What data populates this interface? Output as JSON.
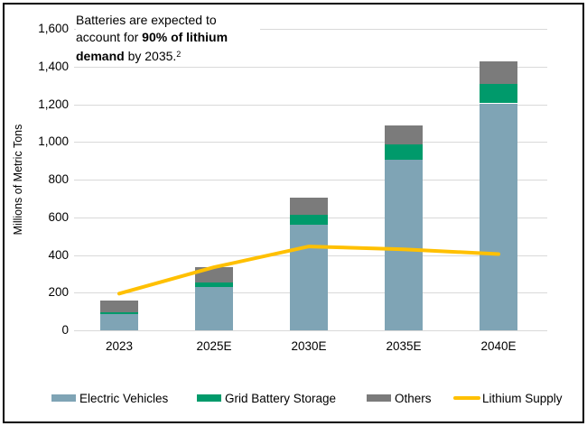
{
  "annotation": {
    "part1": "Batteries are expected to account for ",
    "bold": "90% of lithium demand",
    "part2": " by 2035.",
    "superscript": "2"
  },
  "chart_data": {
    "type": "bar",
    "subtype": "stacked-column-with-line",
    "title": "Batteries are expected to account for 90% of lithium demand by 2035.",
    "categories": [
      "2023",
      "2025E",
      "2030E",
      "2035E",
      "2040E"
    ],
    "series": [
      {
        "name": "Electric Vehicles",
        "color": "#7FA4B5",
        "values": [
          85,
          230,
          560,
          905,
          1205
        ]
      },
      {
        "name": "Grid Battery Storage",
        "color": "#009A6B",
        "values": [
          10,
          25,
          55,
          80,
          105
        ]
      },
      {
        "name": "Others",
        "color": "#7B7B7B",
        "values": [
          65,
          80,
          90,
          105,
          120
        ]
      }
    ],
    "line": {
      "name": "Lithium Supply",
      "color": "#FFC000",
      "values": [
        195,
        335,
        445,
        430,
        405
      ]
    },
    "xlabel": "",
    "ylabel": "Millions of Metric Tons",
    "ylim": [
      0,
      1600
    ],
    "ytick_step": 200,
    "grid": true,
    "gridline_color": "#D9D9D9",
    "legend_position": "bottom"
  }
}
